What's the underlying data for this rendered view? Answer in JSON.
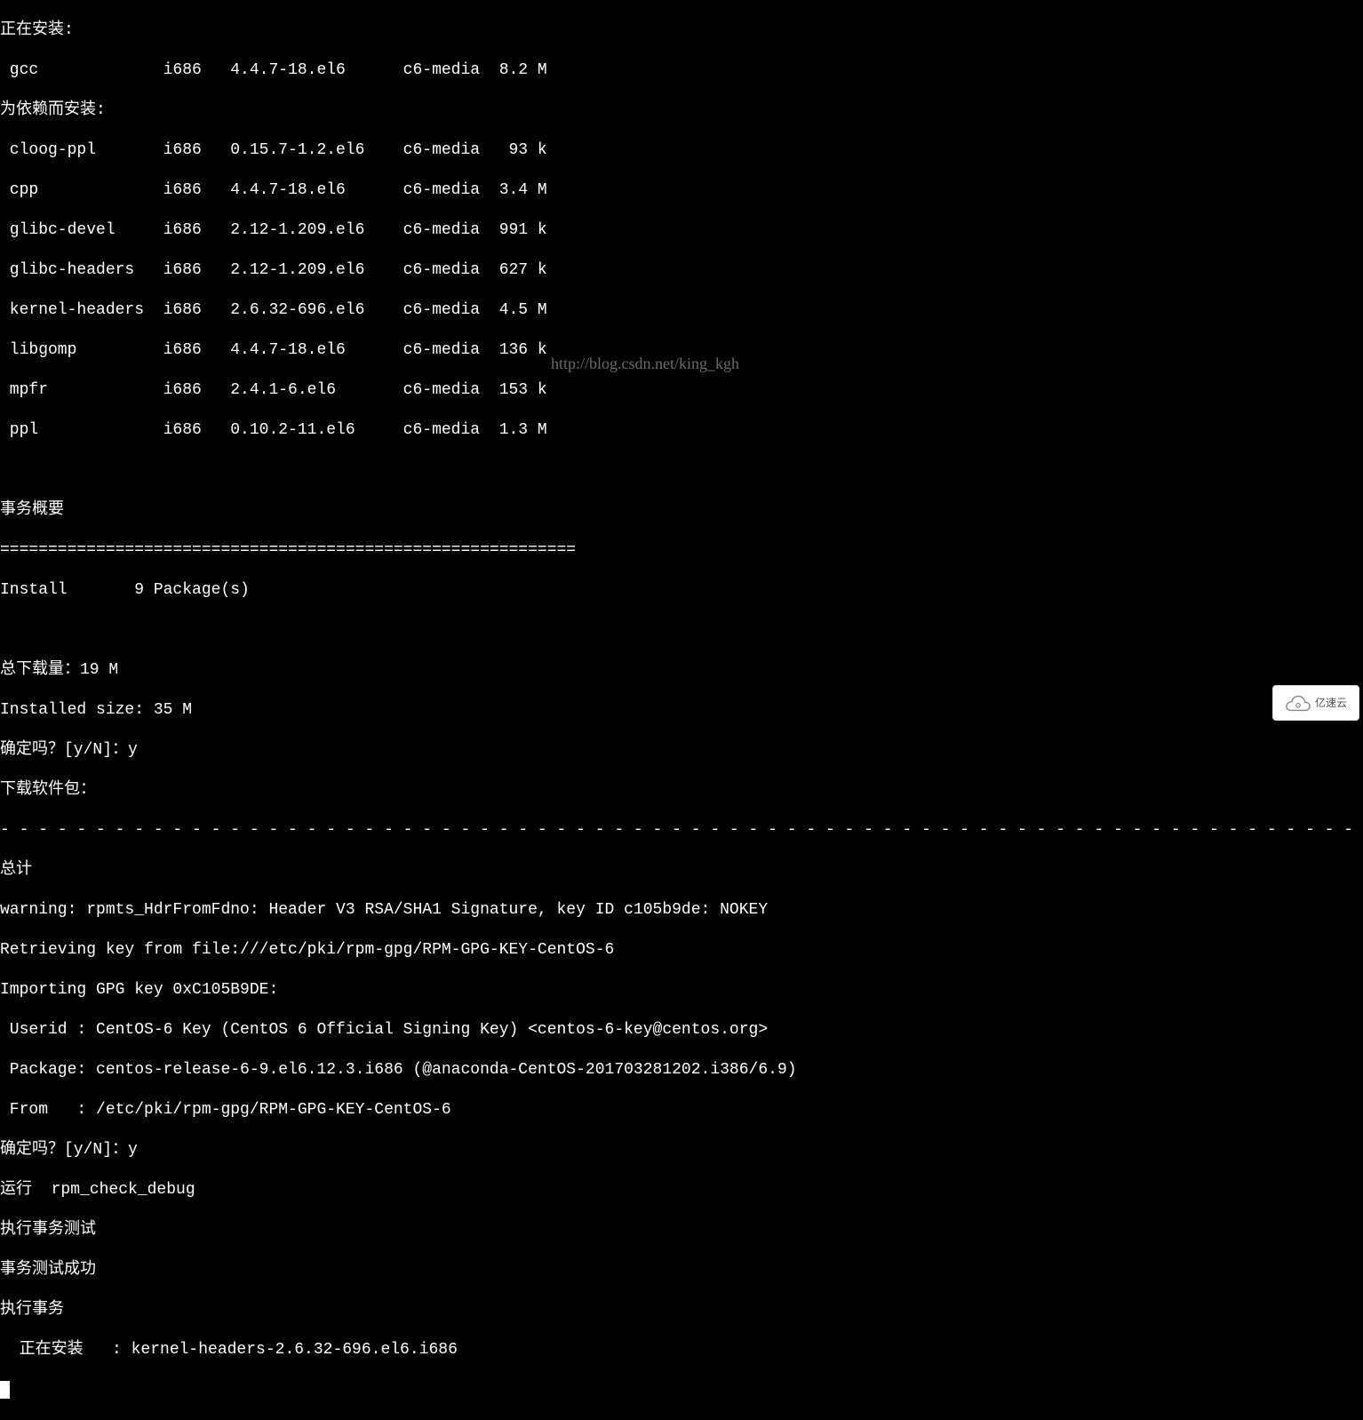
{
  "sections": {
    "installing_header": "正在安装:",
    "main_package": {
      "name": " gcc",
      "arch": "i686",
      "version": "4.4.7-18.el6",
      "repo": "c6-media",
      "size": "8.2 M"
    },
    "deps_header": "为依赖而安装:",
    "dependencies": [
      {
        "name": " cloog-ppl",
        "arch": "i686",
        "version": "0.15.7-1.2.el6",
        "repo": "c6-media",
        "size": " 93 k"
      },
      {
        "name": " cpp",
        "arch": "i686",
        "version": "4.4.7-18.el6",
        "repo": "c6-media",
        "size": "3.4 M"
      },
      {
        "name": " glibc-devel",
        "arch": "i686",
        "version": "2.12-1.209.el6",
        "repo": "c6-media",
        "size": "991 k"
      },
      {
        "name": " glibc-headers",
        "arch": "i686",
        "version": "2.12-1.209.el6",
        "repo": "c6-media",
        "size": "627 k"
      },
      {
        "name": " kernel-headers",
        "arch": "i686",
        "version": "2.6.32-696.el6",
        "repo": "c6-media",
        "size": "4.5 M"
      },
      {
        "name": " libgomp",
        "arch": "i686",
        "version": "4.4.7-18.el6",
        "repo": "c6-media",
        "size": "136 k"
      },
      {
        "name": " mpfr",
        "arch": "i686",
        "version": "2.4.1-6.el6",
        "repo": "c6-media",
        "size": "153 k"
      },
      {
        "name": " ppl",
        "arch": "i686",
        "version": "0.10.2-11.el6",
        "repo": "c6-media",
        "size": "1.3 M"
      }
    ],
    "summary_header": "事务概要",
    "separator_eq": "============================================================",
    "install_count": "Install       9 Package(s)",
    "total_download": "总下载量：19 M",
    "installed_size": "Installed size: 35 M",
    "confirm1": "确定吗？[y/N]：y",
    "downloading": "下载软件包：",
    "total": "总计",
    "warning": "warning: rpmts_HdrFromFdno: Header V3 RSA/SHA1 Signature, key ID c105b9de: NOKEY",
    "retrieving": "Retrieving key from file:///etc/pki/rpm-gpg/RPM-GPG-KEY-CentOS-6",
    "importing": "Importing GPG key 0xC105B9DE:",
    "userid": " Userid : CentOS-6 Key (CentOS 6 Official Signing Key) <centos-6-key@centos.org>",
    "package": " Package: centos-release-6-9.el6.12.3.i686 (@anaconda-CentOS-201703281202.i386/6.9)",
    "from": " From   : /etc/pki/rpm-gpg/RPM-GPG-KEY-CentOS-6",
    "confirm2": "确定吗？[y/N]：y",
    "running": "运行  rpm_check_debug",
    "test": "执行事务测试",
    "testok": "事务测试成功",
    "exec": "执行事务",
    "installing_pkg": "  正在安装   : kernel-headers-2.6.32-696.el6.i686"
  },
  "watermark": "http://blog.csdn.net/king_kgh",
  "logo_text": "亿速云"
}
